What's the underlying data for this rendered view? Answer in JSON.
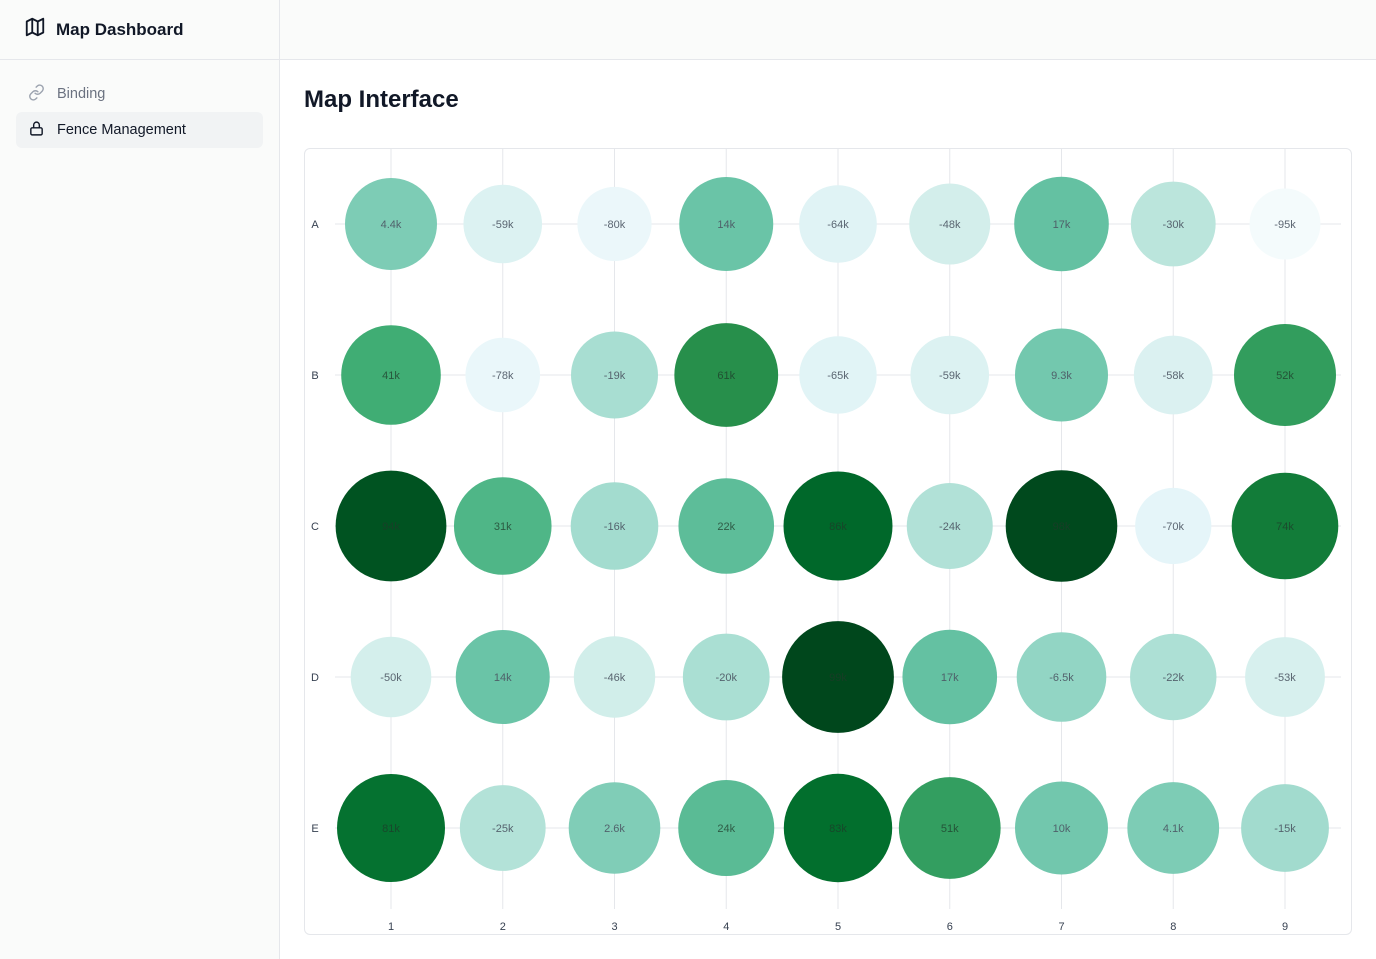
{
  "sidebar": {
    "title": "Map Dashboard",
    "brand_icon": "map-icon",
    "items": [
      {
        "label": "Binding",
        "icon": "link-icon",
        "active": false
      },
      {
        "label": "Fence Management",
        "icon": "lock-icon",
        "active": true
      }
    ]
  },
  "main": {
    "title": "Map Interface"
  },
  "colors": {
    "sidebar_bg": "#fafbfa",
    "border": "#e5e7eb",
    "active_bg": "#f1f3f4",
    "scale_low": "#f7fcfd",
    "scale_high": "#00441b"
  },
  "chart_data": {
    "type": "scatter",
    "title": "",
    "xlabel": "",
    "ylabel": "",
    "x_categories": [
      "1",
      "2",
      "3",
      "4",
      "5",
      "6",
      "7",
      "8",
      "9"
    ],
    "y_categories": [
      "A",
      "B",
      "C",
      "D",
      "E"
    ],
    "value_range": [
      -100000,
      100000
    ],
    "grid": true,
    "encoding": "bubble size and green color intensity by value",
    "rows": [
      {
        "row": "A",
        "values": [
          4400,
          -59000,
          -80000,
          14000,
          -64000,
          -48000,
          17000,
          -30000,
          -95000
        ],
        "labels": [
          "4.4k",
          "-59k",
          "-80k",
          "14k",
          "-64k",
          "-48k",
          "17k",
          "-30k",
          "-95k"
        ]
      },
      {
        "row": "B",
        "values": [
          41000,
          -78000,
          -19000,
          61000,
          -65000,
          -59000,
          9300,
          -58000,
          52000
        ],
        "labels": [
          "41k",
          "-78k",
          "-19k",
          "61k",
          "-65k",
          "-59k",
          "9.3k",
          "-58k",
          "52k"
        ]
      },
      {
        "row": "C",
        "values": [
          94000,
          31000,
          -16000,
          22000,
          86000,
          -24000,
          98000,
          -70000,
          74000
        ],
        "labels": [
          "94k",
          "31k",
          "-16k",
          "22k",
          "86k",
          "-24k",
          "98k",
          "-70k",
          "74k"
        ]
      },
      {
        "row": "D",
        "values": [
          -50000,
          14000,
          -46000,
          -20000,
          99000,
          17000,
          -6500,
          -22000,
          -53000
        ],
        "labels": [
          "-50k",
          "14k",
          "-46k",
          "-20k",
          "99k",
          "17k",
          "-6.5k",
          "-22k",
          "-53k"
        ]
      },
      {
        "row": "E",
        "values": [
          81000,
          -25000,
          2600,
          24000,
          83000,
          51000,
          10000,
          4100,
          -15000
        ],
        "labels": [
          "81k",
          "-25k",
          "2.6k",
          "24k",
          "83k",
          "51k",
          "10k",
          "4.1k",
          "-15k"
        ]
      }
    ]
  }
}
